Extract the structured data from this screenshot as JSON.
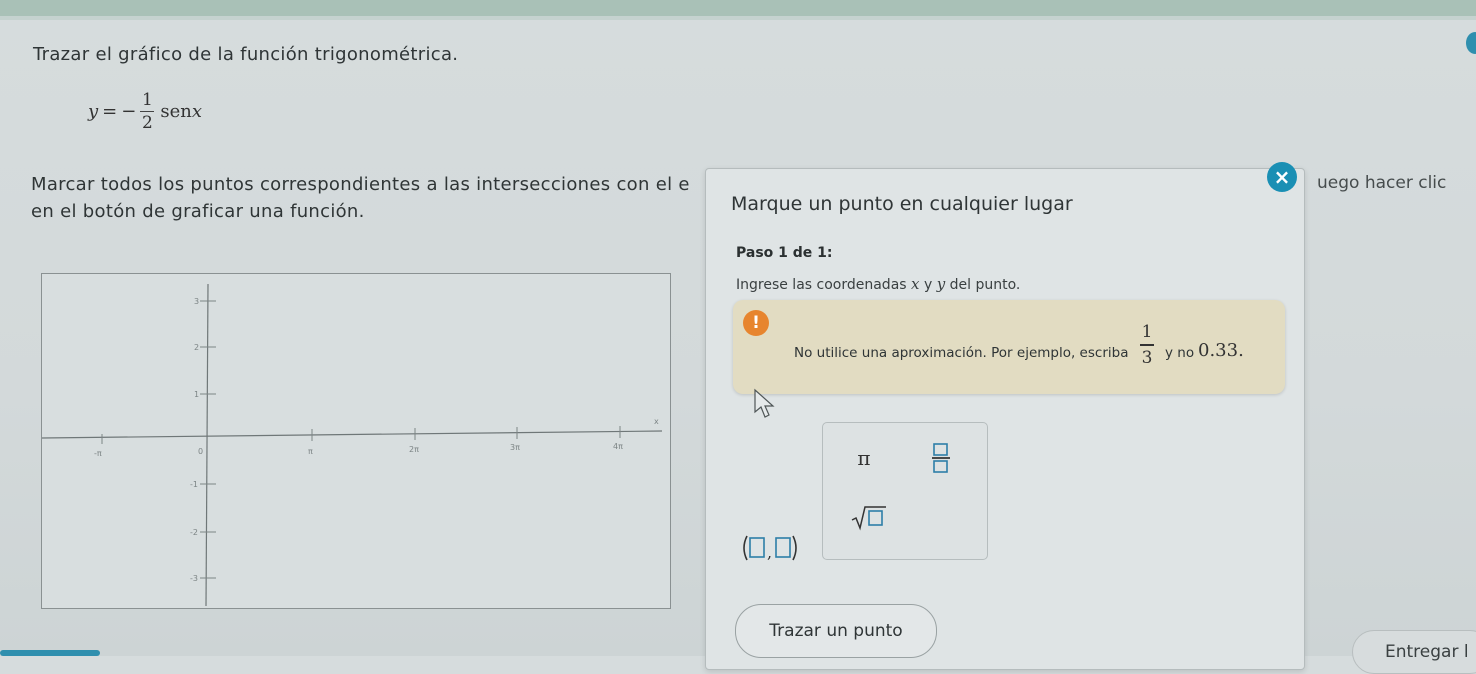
{
  "question": {
    "prompt": "Trazar el gráfico de la función trigonométrica.",
    "formula": {
      "lhs": "y",
      "equals": "=",
      "sign": "−",
      "numerator": "1",
      "denominator": "2",
      "function": "sen",
      "variable": "x"
    },
    "instructions_line1": "Marcar todos los puntos correspondientes a las intersecciones con el e",
    "instructions_line2": "en el botón de graficar una función.",
    "instructions_tail": "uego hacer clic"
  },
  "graph": {
    "y_tick_labels": [
      "3",
      "2",
      "1",
      "-1",
      "-2",
      "-3"
    ],
    "x_tick_labels": [
      "-π",
      "0",
      "π",
      "2π",
      "3π",
      "4π"
    ],
    "x_axis_label": "x"
  },
  "dialog": {
    "title": "Marque un punto en cualquier lugar",
    "step": "Paso 1 de 1:",
    "ask_prefix": "Ingrese las coordenadas",
    "ask_x": "x",
    "ask_and": "y",
    "ask_y": "y",
    "ask_suffix": "del punto.",
    "warning": {
      "icon": "!",
      "text": "No utilice una aproximación. Por ejemplo, escriba",
      "frac_num": "1",
      "frac_den": "3",
      "y_no": "y no",
      "decimal": "0.33."
    },
    "keypad": {
      "pi": "π"
    },
    "close": "×",
    "plot_button": "Trazar un punto"
  },
  "footer": {
    "submit": "Entregar l"
  },
  "colors": {
    "accent": "#1a8fb4",
    "warning_bg": "#e2dcc2",
    "warning_icon": "#e7852e"
  }
}
